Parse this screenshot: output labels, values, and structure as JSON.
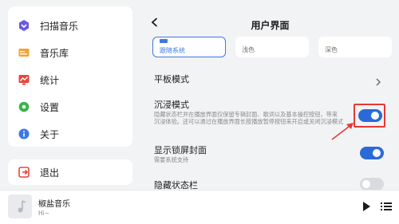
{
  "sidebar": {
    "items": [
      {
        "label": "扫描音乐",
        "icon": "scan-icon",
        "color": "#6a5ae0"
      },
      {
        "label": "音乐库",
        "icon": "library-icon",
        "color": "#f2a33a"
      },
      {
        "label": "统计",
        "icon": "stats-icon",
        "color": "#e8453c"
      },
      {
        "label": "设置",
        "icon": "settings-icon",
        "color": "#3bb54a"
      },
      {
        "label": "关于",
        "icon": "info-icon",
        "color": "#3b78e7"
      }
    ],
    "exit_label": "退出",
    "exit_icon": "exit-icon",
    "exit_color": "#e8453c"
  },
  "header": {
    "title": "用户界面"
  },
  "theme": {
    "options": [
      {
        "label": "跟随系统",
        "selected": true
      },
      {
        "label": "浅色",
        "selected": false
      },
      {
        "label": "深色",
        "selected": false
      }
    ]
  },
  "settings": {
    "tablet_mode": {
      "title": "平板模式"
    },
    "immersive": {
      "title": "沉浸模式",
      "desc_line1": "隐藏状态栏并在播放界面仅保留专辑封面、歌词以及基本操控按钮，带来",
      "desc_line2": "沉浸体验。还可以通过在播放界面长按播放暂停按钮来开启或关闭沉浸模式",
      "enabled": true
    },
    "lockscreen_cover": {
      "title": "显示锁屏封面",
      "desc": "需要系统支持",
      "enabled": true
    },
    "hide_statusbar": {
      "title": "隐藏状态栏",
      "enabled": false
    }
  },
  "player": {
    "song": "椒盐音乐",
    "artist": "Hi~"
  },
  "colors": {
    "accent": "#2a6ad8",
    "highlight": "#e53935"
  }
}
